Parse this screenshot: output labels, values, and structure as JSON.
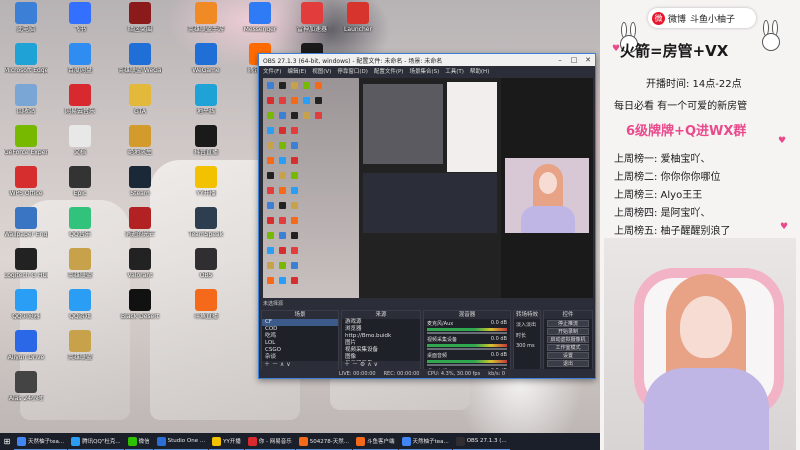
{
  "desktop_icons": [
    {
      "label": "此电脑",
      "icon": "computer-icon",
      "color": "#3b7fd6"
    },
    {
      "label": "Microsoft Edge",
      "icon": "edge-icon",
      "color": "#1fa3d6"
    },
    {
      "label": "回收站",
      "icon": "recycle-bin-icon",
      "color": "#7aa6d6"
    },
    {
      "label": "GeForce Experience",
      "icon": "geforce-icon",
      "color": "#76b900"
    },
    {
      "label": "WPS Office",
      "icon": "wps-icon",
      "color": "#d62e2e"
    },
    {
      "label": "Wallpaper Engine",
      "icon": "wallpaper-icon",
      "color": "#3a75c4"
    },
    {
      "label": "Logitech G HUB",
      "icon": "ghub-icon",
      "color": "#222222"
    },
    {
      "label": "QQ浏览器",
      "icon": "qq-browser-icon",
      "color": "#2a9df4"
    },
    {
      "label": "Aliyun Drive",
      "icon": "aliyun-icon",
      "color": "#2b68e8"
    },
    {
      "label": "Alas 24小时",
      "icon": "alas-icon",
      "color": "#444444"
    },
    {
      "label": "飞书",
      "icon": "feishu-icon",
      "color": "#3370ff"
    },
    {
      "label": "百度网盘",
      "icon": "baidu-disk-icon",
      "color": "#2f8cf0"
    },
    {
      "label": "网易云音乐",
      "icon": "netease-icon",
      "color": "#d8292f"
    },
    {
      "label": "文档",
      "icon": "document-icon",
      "color": "#e8e8e8"
    },
    {
      "label": "Epic",
      "icon": "epic-icon",
      "color": "#333333"
    },
    {
      "label": "QQ音乐",
      "icon": "qq-music-icon",
      "color": "#31c27c"
    },
    {
      "label": "英雄联盟",
      "icon": "lol-icon",
      "color": "#c8a14b"
    },
    {
      "label": "QQ游戏",
      "icon": "qq-game-icon",
      "color": "#2a9df4"
    },
    {
      "label": "英雄联盟",
      "icon": "lol-icon",
      "color": "#c8a14b"
    },
    {
      "label": "暗区突围",
      "icon": "arena-icon",
      "color": "#8b1a1a"
    },
    {
      "label": "英雄联盟 WeGame",
      "icon": "wegame-icon",
      "color": "#1f6fd6"
    },
    {
      "label": "GTA",
      "icon": "gta-icon",
      "color": "#e2b93b"
    },
    {
      "label": "绝地求生",
      "icon": "pubg-icon",
      "color": "#d29b2c"
    },
    {
      "label": "Steam",
      "icon": "steam-icon",
      "color": "#1b2838"
    },
    {
      "label": "消逝的光芒",
      "icon": "dying-light-icon",
      "color": "#b22222"
    },
    {
      "label": "Valorant",
      "icon": "valorant-icon",
      "color": "#222222"
    },
    {
      "label": "Black Desert",
      "icon": "black-desert-icon",
      "color": "#111111"
    },
    {
      "label": "英雄联盟手游",
      "icon": "wild-rift-icon",
      "color": "#f08a24"
    },
    {
      "label": "WeGame",
      "icon": "wegame-icon",
      "color": "#1f6fd6"
    },
    {
      "label": "地平线",
      "icon": "horizon-icon",
      "color": "#1fa3d6"
    },
    {
      "label": "抖音直播",
      "icon": "douyin-icon",
      "color": "#1a1a1a"
    },
    {
      "label": "YY开播",
      "icon": "yy-icon",
      "color": "#f2c200"
    },
    {
      "label": "TeamSpeak",
      "icon": "teamspeak-icon",
      "color": "#2c3e50"
    },
    {
      "label": "OBS",
      "icon": "obs-icon",
      "color": "#302e31"
    },
    {
      "label": "斗鱼直播",
      "icon": "douyu-icon",
      "color": "#f56a1a"
    },
    {
      "label": "Messenger",
      "icon": "messenger-icon",
      "color": "#2f7bf5"
    },
    {
      "label": "腾讯视频",
      "icon": "tencent-video-icon",
      "color": "#ff6b00"
    },
    {
      "label": "雷神加速器",
      "icon": "leishen-icon",
      "color": "#e23c3c"
    },
    {
      "label": "MW",
      "icon": "mw-icon",
      "color": "#1a1a1a"
    },
    {
      "label": "Launcher",
      "icon": "launcher-icon",
      "color": "#d6342c"
    }
  ],
  "obs": {
    "title": "OBS 27.1.3 (64-bit, windows) - 配置文件: 未命名 - 场景: 未命名",
    "menu": [
      "文件(F)",
      "编辑(E)",
      "视图(V)",
      "停靠窗口(D)",
      "配置文件(P)",
      "场景集合(S)",
      "工具(T)",
      "帮助(H)"
    ],
    "source_none": "未选择源",
    "panels": {
      "scenes": {
        "title": "场景",
        "items": [
          "CF",
          "COD",
          "吃鸡",
          "LOL",
          "CSGO",
          "杂谈"
        ],
        "selected": 0
      },
      "sources": {
        "title": "来源",
        "items": [
          "游戏源",
          "浏览器",
          "http://Bmo.buidk",
          "图片",
          "视频采集设备",
          "图像",
          "显示器采集",
          "添加分享源"
        ]
      },
      "mixer": {
        "title": "混音器",
        "channels": [
          {
            "name": "麦克风/Aux",
            "db": "0.0 dB"
          },
          {
            "name": "视频采集设备",
            "db": "0.0 dB"
          },
          {
            "name": "桌面音频",
            "db": "0.0 dB"
          },
          {
            "name": "桌面音频 2",
            "db": "0.0 dB"
          }
        ]
      },
      "transitions": {
        "title": "转场特效",
        "type": "淡入淡出",
        "duration_label": "时长",
        "duration": "300 ms"
      },
      "controls": {
        "title": "控件",
        "buttons": [
          "停止推流",
          "开始录制",
          "启动虚拟摄像机",
          "工作室模式",
          "设置",
          "退出"
        ]
      }
    },
    "status": {
      "live": "LIVE: 00:00:00",
      "rec": "REC: 00:00:00",
      "cpu": "CPU: 4.3%, 30.00 fps",
      "bitrate": "kb/s: 0"
    }
  },
  "overlay": {
    "weibo_label": "微博",
    "weibo_name": "斗鱼小柚子",
    "title": "火箭=房管+VX",
    "time": "开播时间: 14点-22点",
    "daily": "每日必看 有一个可爱的新房管",
    "fan": "6级牌牌+Q进WX群",
    "ranks": [
      "上周榜一: 爱柚宝吖、",
      "上周榜二: 你你你你哪位",
      "上周榜三: Alyo王王",
      "上周榜四: 是阿宝吖、",
      "上周榜五: 柚子醒醒别浪了"
    ],
    "accent": "#e94a8c"
  },
  "taskbar": [
    {
      "label": "天然柚子tea...",
      "icon": "chrome-icon",
      "color": "#4285f4"
    },
    {
      "label": "腾讯QQ\"杜克...",
      "icon": "qq-icon",
      "color": "#2a9df4"
    },
    {
      "label": "微信",
      "icon": "wechat-icon",
      "color": "#2dc100"
    },
    {
      "label": "Studio One ...",
      "icon": "studio-one-icon",
      "color": "#2b6ed6"
    },
    {
      "label": "YY开播",
      "icon": "yy-icon",
      "color": "#f2c200"
    },
    {
      "label": "你 - 网易音乐",
      "icon": "netease-icon",
      "color": "#d8292f"
    },
    {
      "label": "504278-天然...",
      "icon": "douyu-icon",
      "color": "#f56a1a"
    },
    {
      "label": "斗鱼客户端",
      "icon": "douyu-client-icon",
      "color": "#f56a1a"
    },
    {
      "label": "天然柚子tea...",
      "icon": "chrome-icon",
      "color": "#4285f4"
    },
    {
      "label": "OBS 27.1.3 (...",
      "icon": "obs-icon",
      "color": "#302e31"
    }
  ]
}
